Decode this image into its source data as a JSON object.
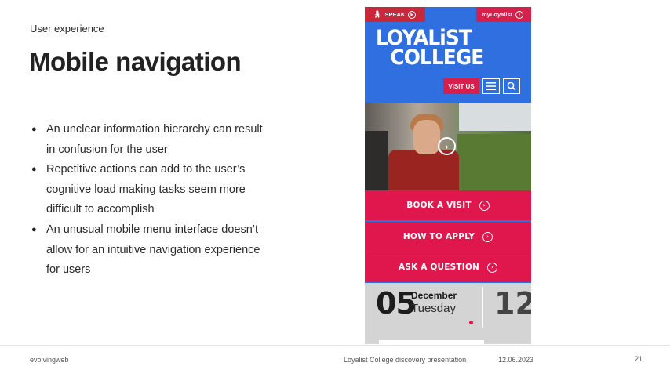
{
  "slide": {
    "eyebrow": "User experience",
    "title": "Mobile navigation",
    "bullets": [
      "An unclear information hierarchy can result in confusion for the user",
      "Repetitive actions can add to the user’s cognitive load making tasks seem more difficult to accomplish",
      "An unusual mobile menu interface doesn’t allow for an intuitive navigation experience for users"
    ]
  },
  "phone": {
    "speak_label": "SPEAK",
    "myloyalist_label": "myLoyalist",
    "logo_line1": "LOYALiST",
    "logo_line2": "COLLEGE",
    "visit_label": "VISIT US",
    "cta": [
      "BOOK A VISIT",
      "HOW TO APPLY",
      "ASK A QUESTION"
    ],
    "calendar": {
      "day": "05",
      "month": "December",
      "weekday": "Tuesday",
      "next_day": "12"
    },
    "colors": {
      "brand_blue": "#2f6fe0",
      "brand_red": "#e0174d"
    }
  },
  "footer": {
    "left": "evolvingweb",
    "center": "Loyalist College discovery presentation",
    "date": "12.06.2023",
    "page": "21"
  }
}
